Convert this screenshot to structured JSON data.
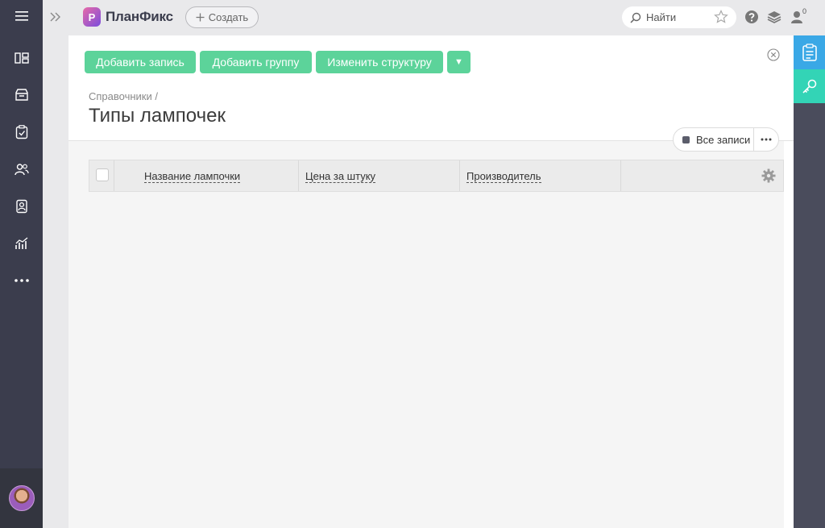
{
  "app": {
    "name": "ПланФикс",
    "logo_letter": "P",
    "create_label": "Создать",
    "search_placeholder": "Найти",
    "notification_count": "0"
  },
  "toolbar": {
    "add_record": "Добавить запись",
    "add_group": "Добавить группу",
    "change_structure": "Изменить структуру",
    "more_arrow": "▼"
  },
  "breadcrumb": "Справочники /",
  "page_title": "Типы лампочек",
  "records_filter": {
    "label": "Все записи",
    "more": "···"
  },
  "table": {
    "columns": [
      "Название лампочки",
      "Цена за штуку",
      "Производитель"
    ]
  },
  "colors": {
    "sidebar": "#3b3d4d",
    "accent_green": "#5cd39a",
    "rail_blue": "#3aa8e6",
    "rail_teal": "#33d4b6"
  },
  "icons": {
    "sidebar": [
      "menu-icon",
      "boards-icon",
      "tasks-box-icon",
      "checklist-icon",
      "contacts-icon",
      "employees-icon",
      "reports-icon",
      "more-icon"
    ],
    "right_rail": [
      "clipboard-icon",
      "key-icon"
    ]
  }
}
